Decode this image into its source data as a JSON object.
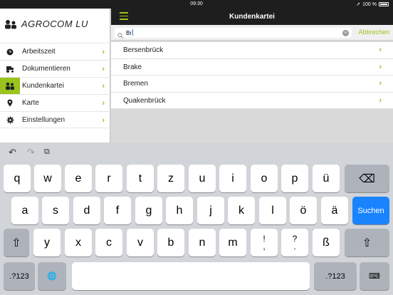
{
  "status_bar": {
    "time": "09:30",
    "battery_percent": "100 %",
    "location_arrow": "➚"
  },
  "sidebar": {
    "logo_text": "AGROCOM LU",
    "items": [
      {
        "label": "Arbeitszeit",
        "icon": "clock-icon",
        "active": false
      },
      {
        "label": "Dokumentieren",
        "icon": "tractor-icon",
        "active": false
      },
      {
        "label": "Kundenkartei",
        "icon": "people-icon",
        "active": true
      },
      {
        "label": "Karte",
        "icon": "map-pin-icon",
        "active": false
      },
      {
        "label": "Einstellungen",
        "icon": "gear-icon",
        "active": false
      }
    ],
    "chevron": "›"
  },
  "navbar": {
    "title": "Kundenkartei",
    "menu_icon": "hamburger-icon"
  },
  "search": {
    "value": "Br",
    "cancel_label": "Abbrechen",
    "clear_glyph": "×"
  },
  "results": [
    {
      "label": "Bersenbrück"
    },
    {
      "label": "Brake"
    },
    {
      "label": "Bremen"
    },
    {
      "label": "Quakenbrück"
    }
  ],
  "keyboard": {
    "toolbar": {
      "undo": "↶",
      "redo": "↷",
      "paste": "⧉"
    },
    "row1": [
      "q",
      "w",
      "e",
      "r",
      "t",
      "z",
      "u",
      "i",
      "o",
      "p",
      "ü"
    ],
    "row2": [
      "a",
      "s",
      "d",
      "f",
      "g",
      "h",
      "j",
      "k",
      "l",
      "ö",
      "ä"
    ],
    "row3": [
      "y",
      "x",
      "c",
      "v",
      "b",
      "n",
      "m"
    ],
    "row3_punct": [
      {
        "top": "!",
        "bottom": ","
      },
      {
        "top": "?",
        "bottom": "."
      }
    ],
    "row3_extra": "ß",
    "backspace": "⌫",
    "shift": "⇧",
    "search_key": "Suchen",
    "numbers_key": ".?123",
    "globe": "🌐",
    "hide_keyboard": "⌨"
  },
  "colors": {
    "accent": "#9ac31c",
    "dark_bar": "#1e1e1e",
    "keyboard_bg": "#d1d4d9",
    "search_key": "#1a84ff"
  }
}
